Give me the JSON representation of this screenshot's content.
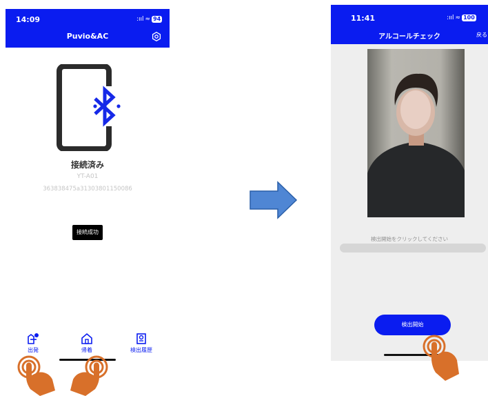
{
  "left_phone": {
    "status": {
      "time": "14:09",
      "signal": ":ııl",
      "wifi": "≈",
      "battery": "94"
    },
    "app_title": "Puvio&AC",
    "connection_status": "接続済み",
    "device_name": "YT-A01",
    "device_id": "363838475a31303801150086",
    "toast": "接続成功",
    "tabs": [
      {
        "label": "出発"
      },
      {
        "label": "帰着"
      },
      {
        "label": "検出履歴"
      }
    ]
  },
  "right_phone": {
    "status": {
      "time": "11:41",
      "signal": ":ııl",
      "wifi": "≈",
      "battery": "100"
    },
    "title": "アルコールチェック",
    "back": "戻る",
    "hint": "検出開始をクリックしてください",
    "progress": 0,
    "start_button": "検出開始"
  },
  "colors": {
    "primary": "#0a1cf0",
    "arrow": "#4f86d4",
    "hand": "#d8702a"
  },
  "icons": [
    "settings-gear-icon",
    "bluetooth-icon",
    "tab-depart-icon",
    "tab-return-icon",
    "tab-history-icon",
    "arrow-right-icon",
    "tap-hand-icon"
  ]
}
